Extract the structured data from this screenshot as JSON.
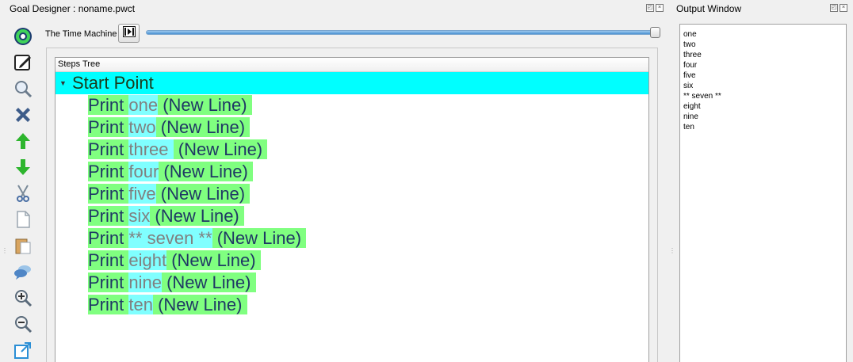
{
  "goal_designer": {
    "title": "Goal Designer : noname.pwct"
  },
  "output_window": {
    "title": "Output Window",
    "lines": [
      "one",
      "two",
      "three",
      "four",
      "five",
      "six",
      "** seven **",
      "eight",
      "nine",
      "ten"
    ]
  },
  "time_machine": {
    "label": "The Time Machine",
    "position": 1.0
  },
  "toolbar": {
    "icons": [
      "logo-icon",
      "edit-icon",
      "search-icon",
      "delete-icon",
      "move-up-icon",
      "move-down-icon",
      "cut-icon",
      "copy-icon",
      "paste-icon",
      "comment-icon",
      "zoom-in-icon",
      "zoom-out-icon",
      "window-icon"
    ]
  },
  "steps_tree": {
    "header": "Steps Tree",
    "root": {
      "label": "Start Point"
    },
    "steps": [
      {
        "keyword": "Print",
        "value": "one",
        "suffix": "(New Line)"
      },
      {
        "keyword": "Print",
        "value": "two",
        "suffix": "(New Line)"
      },
      {
        "keyword": "Print",
        "value": "three ",
        "suffix": "(New Line)"
      },
      {
        "keyword": "Print",
        "value": "four",
        "suffix": "(New Line)"
      },
      {
        "keyword": "Print",
        "value": "five",
        "suffix": "(New Line)"
      },
      {
        "keyword": "Print",
        "value": "six",
        "suffix": "(New Line)"
      },
      {
        "keyword": "Print",
        "value": "** seven **",
        "suffix": "(New Line)"
      },
      {
        "keyword": "Print",
        "value": "eight",
        "suffix": "(New Line)"
      },
      {
        "keyword": "Print",
        "value": "nine",
        "suffix": "(New Line)"
      },
      {
        "keyword": "Print",
        "value": "ten",
        "suffix": "(New Line)"
      }
    ]
  },
  "colors": {
    "root_highlight": "#00ffff",
    "keyword_bg": "#80ff80",
    "value_bg": "#80ffff",
    "keyword_text": "#1f3864",
    "value_text": "#808080"
  }
}
